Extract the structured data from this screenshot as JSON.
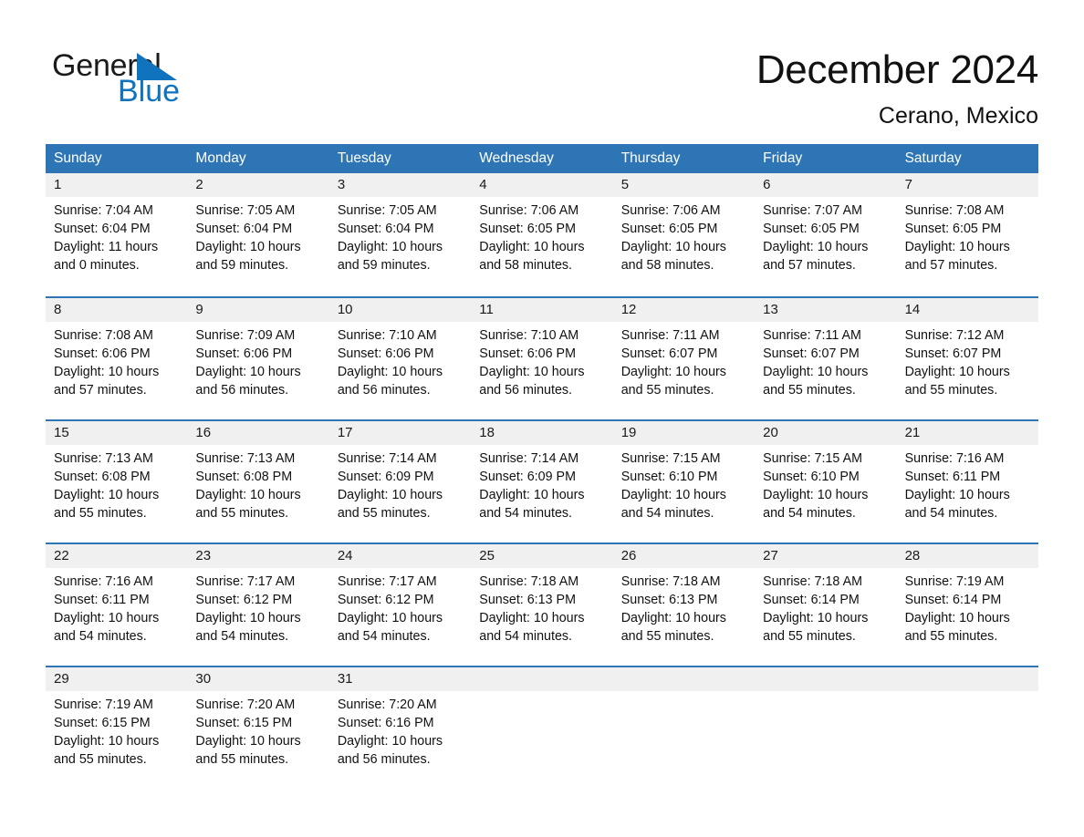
{
  "logo": {
    "word_one": "General",
    "word_two": "Blue",
    "triangle_color": "#1073bd",
    "icon": "triangle-icon"
  },
  "header": {
    "month_title": "December 2024",
    "location": "Cerano, Mexico"
  },
  "colors": {
    "header_blue": "#2e75b6",
    "row_divider_blue": "#2e75b6",
    "daynum_band": "#f0f0f0",
    "text": "#111111",
    "logo_blue": "#1073bd"
  },
  "calendar": {
    "day_headers": [
      "Sunday",
      "Monday",
      "Tuesday",
      "Wednesday",
      "Thursday",
      "Friday",
      "Saturday"
    ],
    "weeks": [
      [
        {
          "day": "1",
          "info": "Sunrise: 7:04 AM\nSunset: 6:04 PM\nDaylight: 11 hours and 0 minutes."
        },
        {
          "day": "2",
          "info": "Sunrise: 7:05 AM\nSunset: 6:04 PM\nDaylight: 10 hours and 59 minutes."
        },
        {
          "day": "3",
          "info": "Sunrise: 7:05 AM\nSunset: 6:04 PM\nDaylight: 10 hours and 59 minutes."
        },
        {
          "day": "4",
          "info": "Sunrise: 7:06 AM\nSunset: 6:05 PM\nDaylight: 10 hours and 58 minutes."
        },
        {
          "day": "5",
          "info": "Sunrise: 7:06 AM\nSunset: 6:05 PM\nDaylight: 10 hours and 58 minutes."
        },
        {
          "day": "6",
          "info": "Sunrise: 7:07 AM\nSunset: 6:05 PM\nDaylight: 10 hours and 57 minutes."
        },
        {
          "day": "7",
          "info": "Sunrise: 7:08 AM\nSunset: 6:05 PM\nDaylight: 10 hours and 57 minutes."
        }
      ],
      [
        {
          "day": "8",
          "info": "Sunrise: 7:08 AM\nSunset: 6:06 PM\nDaylight: 10 hours and 57 minutes."
        },
        {
          "day": "9",
          "info": "Sunrise: 7:09 AM\nSunset: 6:06 PM\nDaylight: 10 hours and 56 minutes."
        },
        {
          "day": "10",
          "info": "Sunrise: 7:10 AM\nSunset: 6:06 PM\nDaylight: 10 hours and 56 minutes."
        },
        {
          "day": "11",
          "info": "Sunrise: 7:10 AM\nSunset: 6:06 PM\nDaylight: 10 hours and 56 minutes."
        },
        {
          "day": "12",
          "info": "Sunrise: 7:11 AM\nSunset: 6:07 PM\nDaylight: 10 hours and 55 minutes."
        },
        {
          "day": "13",
          "info": "Sunrise: 7:11 AM\nSunset: 6:07 PM\nDaylight: 10 hours and 55 minutes."
        },
        {
          "day": "14",
          "info": "Sunrise: 7:12 AM\nSunset: 6:07 PM\nDaylight: 10 hours and 55 minutes."
        }
      ],
      [
        {
          "day": "15",
          "info": "Sunrise: 7:13 AM\nSunset: 6:08 PM\nDaylight: 10 hours and 55 minutes."
        },
        {
          "day": "16",
          "info": "Sunrise: 7:13 AM\nSunset: 6:08 PM\nDaylight: 10 hours and 55 minutes."
        },
        {
          "day": "17",
          "info": "Sunrise: 7:14 AM\nSunset: 6:09 PM\nDaylight: 10 hours and 55 minutes."
        },
        {
          "day": "18",
          "info": "Sunrise: 7:14 AM\nSunset: 6:09 PM\nDaylight: 10 hours and 54 minutes."
        },
        {
          "day": "19",
          "info": "Sunrise: 7:15 AM\nSunset: 6:10 PM\nDaylight: 10 hours and 54 minutes."
        },
        {
          "day": "20",
          "info": "Sunrise: 7:15 AM\nSunset: 6:10 PM\nDaylight: 10 hours and 54 minutes."
        },
        {
          "day": "21",
          "info": "Sunrise: 7:16 AM\nSunset: 6:11 PM\nDaylight: 10 hours and 54 minutes."
        }
      ],
      [
        {
          "day": "22",
          "info": "Sunrise: 7:16 AM\nSunset: 6:11 PM\nDaylight: 10 hours and 54 minutes."
        },
        {
          "day": "23",
          "info": "Sunrise: 7:17 AM\nSunset: 6:12 PM\nDaylight: 10 hours and 54 minutes."
        },
        {
          "day": "24",
          "info": "Sunrise: 7:17 AM\nSunset: 6:12 PM\nDaylight: 10 hours and 54 minutes."
        },
        {
          "day": "25",
          "info": "Sunrise: 7:18 AM\nSunset: 6:13 PM\nDaylight: 10 hours and 54 minutes."
        },
        {
          "day": "26",
          "info": "Sunrise: 7:18 AM\nSunset: 6:13 PM\nDaylight: 10 hours and 55 minutes."
        },
        {
          "day": "27",
          "info": "Sunrise: 7:18 AM\nSunset: 6:14 PM\nDaylight: 10 hours and 55 minutes."
        },
        {
          "day": "28",
          "info": "Sunrise: 7:19 AM\nSunset: 6:14 PM\nDaylight: 10 hours and 55 minutes."
        }
      ],
      [
        {
          "day": "29",
          "info": "Sunrise: 7:19 AM\nSunset: 6:15 PM\nDaylight: 10 hours and 55 minutes."
        },
        {
          "day": "30",
          "info": "Sunrise: 7:20 AM\nSunset: 6:15 PM\nDaylight: 10 hours and 55 minutes."
        },
        {
          "day": "31",
          "info": "Sunrise: 7:20 AM\nSunset: 6:16 PM\nDaylight: 10 hours and 56 minutes."
        },
        {
          "day": "",
          "info": ""
        },
        {
          "day": "",
          "info": ""
        },
        {
          "day": "",
          "info": ""
        },
        {
          "day": "",
          "info": ""
        }
      ]
    ]
  }
}
